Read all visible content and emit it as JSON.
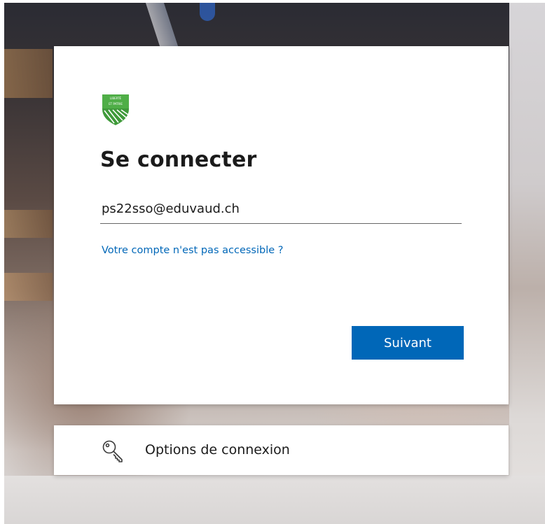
{
  "signin": {
    "logo": {
      "icon": "canton-vaud-shield-icon",
      "motto_line1": "LIBERTÉ",
      "motto_line2": "ET PATRIE",
      "colors": {
        "green": "#3f9a3a",
        "white": "#ffffff",
        "dark_green": "#2d7a2b"
      }
    },
    "title": "Se connecter",
    "email_value": "ps22sso@eduvaud.ch",
    "account_help_link": "Votre compte n'est pas accessible ?",
    "next_button_label": "Suivant"
  },
  "options": {
    "icon": "key-icon",
    "label": "Options de connexion"
  },
  "colors": {
    "accent": "#0067b8",
    "text": "#1b1b1b",
    "card_background": "#ffffff"
  }
}
